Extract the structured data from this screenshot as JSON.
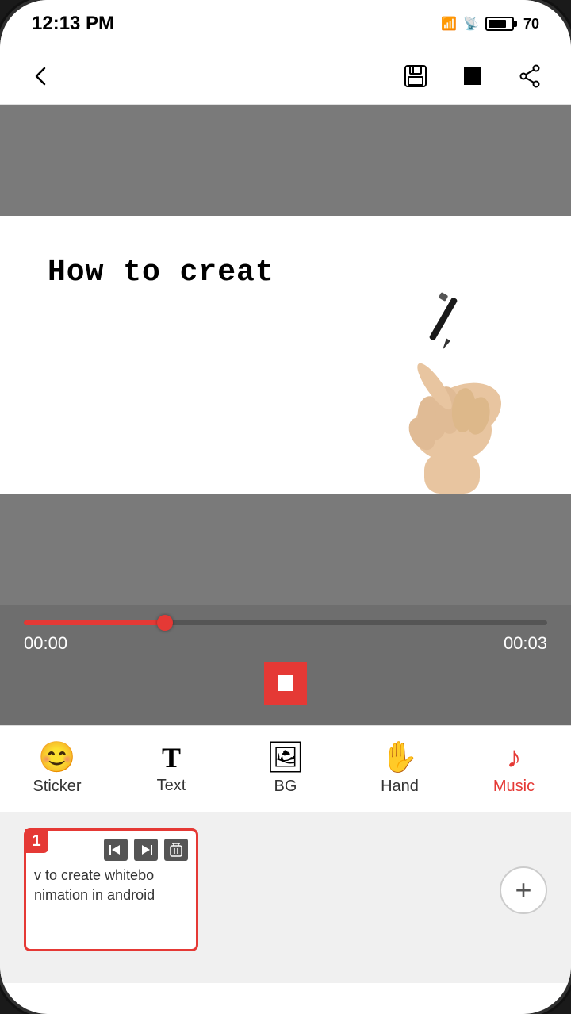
{
  "status_bar": {
    "time": "12:13 PM",
    "battery_level": 70
  },
  "toolbar": {
    "back_label": "←",
    "save_label": "save",
    "stop_label": "stop",
    "share_label": "share"
  },
  "canvas": {
    "text": "How to creat"
  },
  "timeline": {
    "current_time": "00:00",
    "total_time": "00:03",
    "progress_percent": 27
  },
  "tabs": [
    {
      "id": "sticker",
      "label": "Sticker",
      "icon": "😊",
      "active": false
    },
    {
      "id": "text",
      "label": "Text",
      "icon": "T",
      "active": false
    },
    {
      "id": "bg",
      "label": "BG",
      "icon": "🖼",
      "active": false
    },
    {
      "id": "hand",
      "label": "Hand",
      "icon": "✋",
      "active": false
    },
    {
      "id": "music",
      "label": "Music",
      "icon": "♪",
      "active": true
    }
  ],
  "clips": [
    {
      "number": "1",
      "preview": "v to create whitebo\nnimation in android"
    }
  ],
  "add_clip_label": "+"
}
